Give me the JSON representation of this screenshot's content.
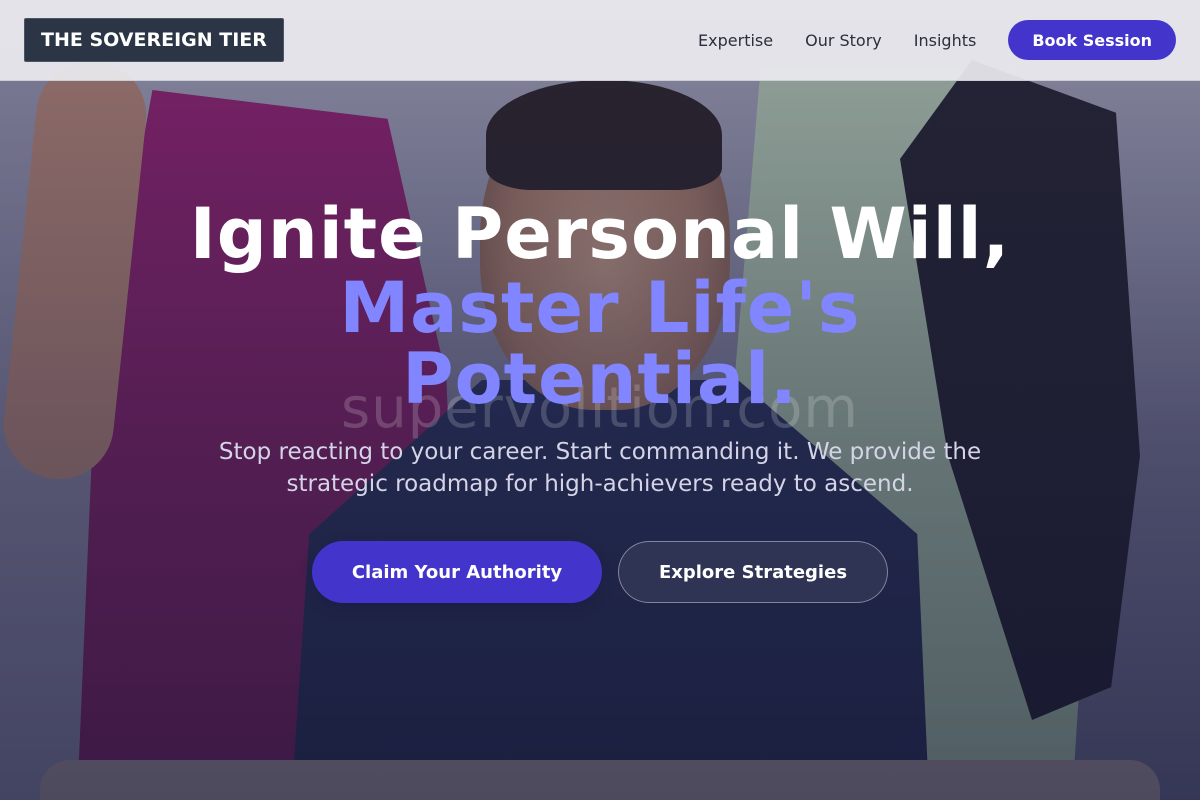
{
  "brand": {
    "name": "THE SOVEREIGN TIER"
  },
  "nav": {
    "links": [
      "Expertise",
      "Our Story",
      "Insights"
    ],
    "cta_label": "Book Session"
  },
  "hero": {
    "headline_line1": "Ignite Personal Will,",
    "headline_line2": "Master Life's",
    "headline_line3": "Potential.",
    "watermark": "supervolition.com",
    "subtext": "Stop reacting to your career. Start commanding it. We provide the strategic roadmap for high-achievers ready to ascend.",
    "primary_cta": "Claim Your Authority",
    "secondary_cta": "Explore Strategies"
  },
  "colors": {
    "accent": "#4334cc",
    "headline_highlight": "#8185ff",
    "logo_bg": "#2c3545"
  }
}
